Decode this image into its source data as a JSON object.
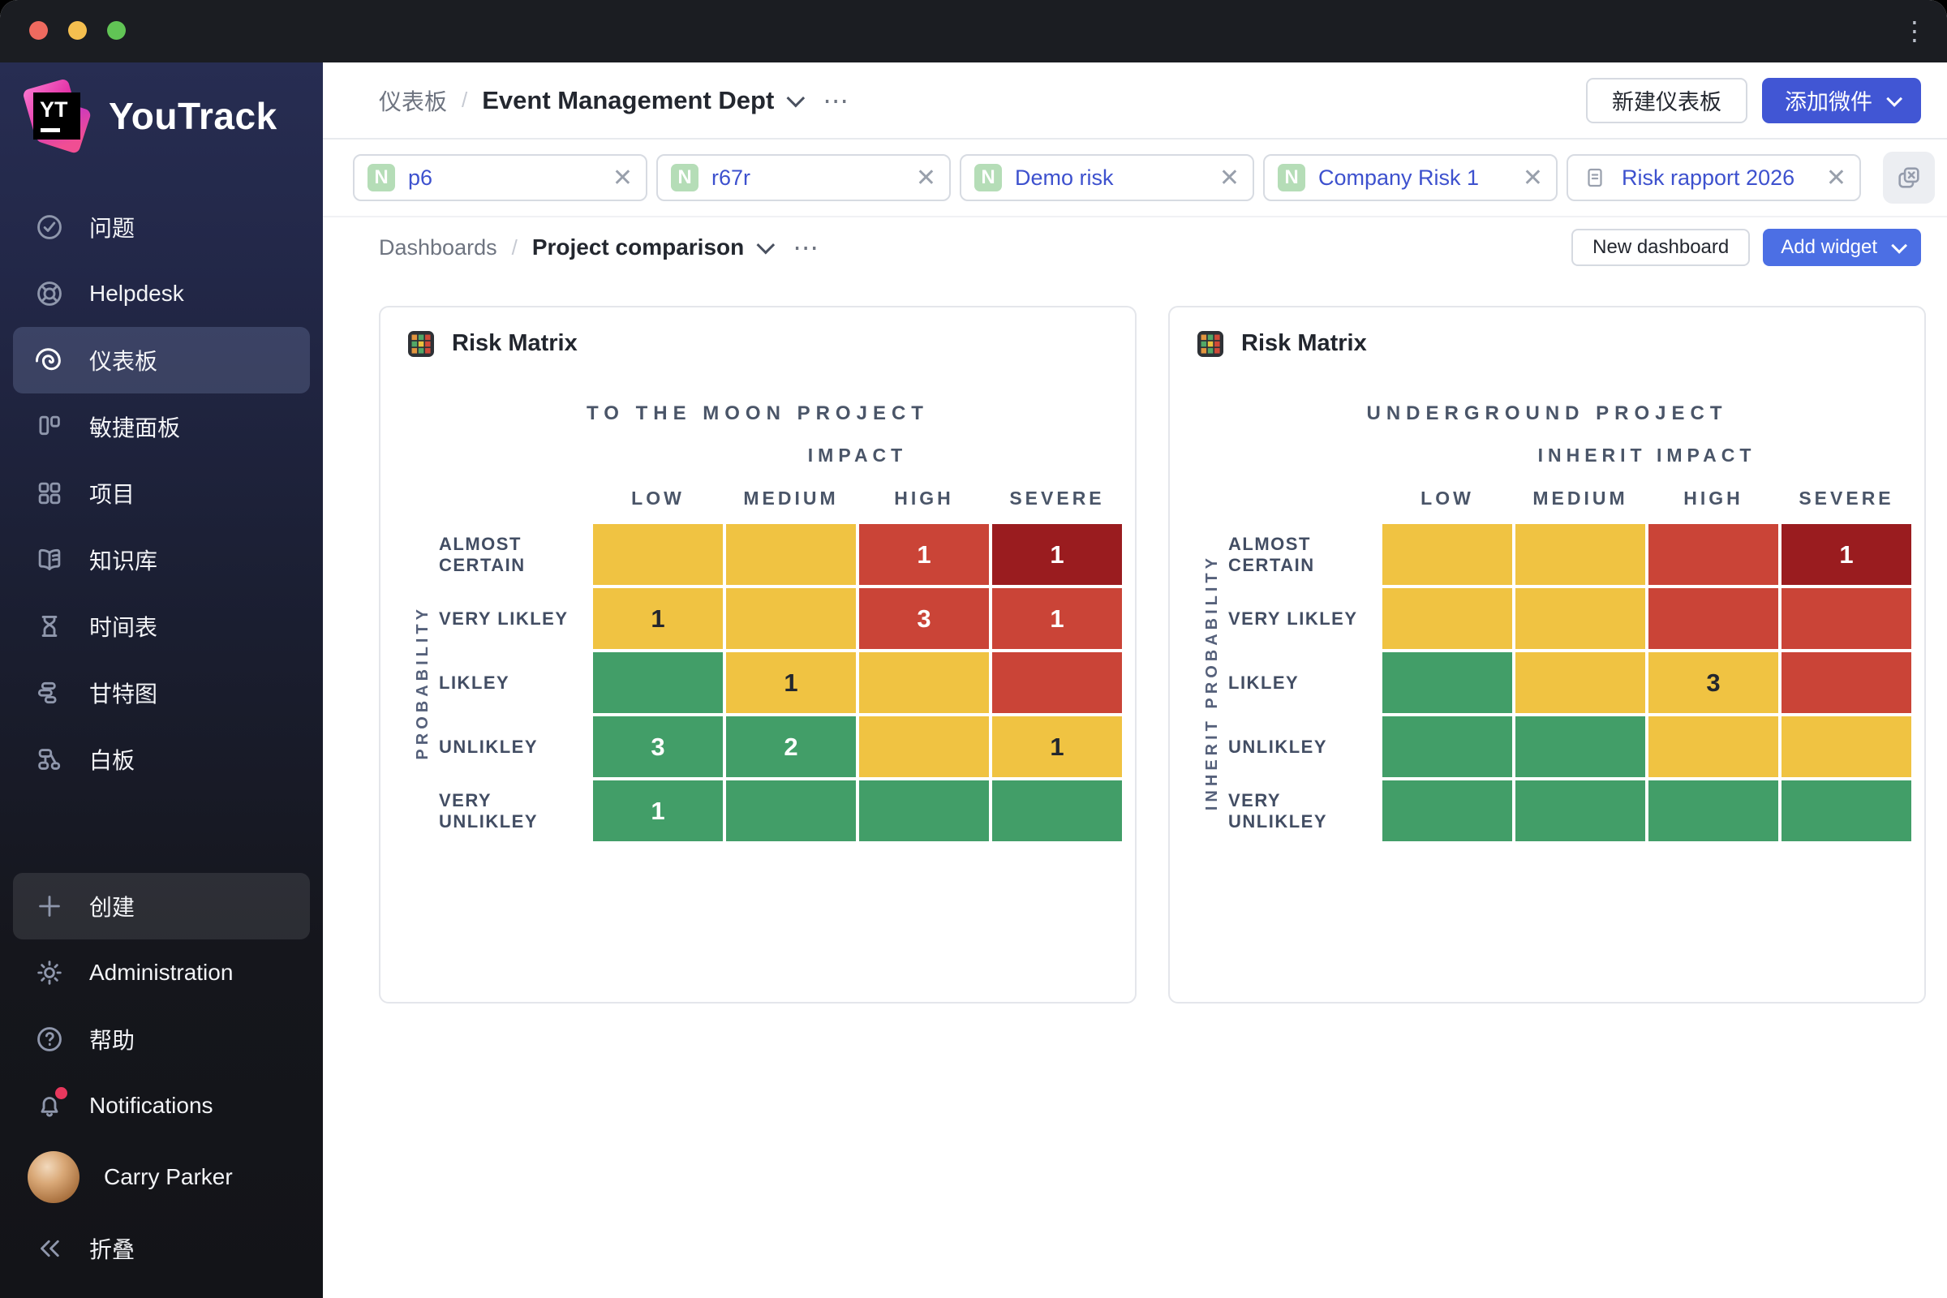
{
  "window": {
    "menu_icon": "⋮"
  },
  "sidebar": {
    "logo": {
      "icon_label": "YT",
      "text": "YouTrack"
    },
    "items": [
      {
        "name": "issues",
        "icon": "check-circle-icon",
        "label": "问题",
        "active": false
      },
      {
        "name": "helpdesk",
        "icon": "helpdesk-icon",
        "label": "Helpdesk",
        "active": false
      },
      {
        "name": "dashboards",
        "icon": "dashboard-icon",
        "label": "仪表板",
        "active": true
      },
      {
        "name": "agile-boards",
        "icon": "agile-board-icon",
        "label": "敏捷面板",
        "active": false
      },
      {
        "name": "projects",
        "icon": "projects-grid-icon",
        "label": "项目",
        "active": false
      },
      {
        "name": "knowledge-base",
        "icon": "knowledge-base-icon",
        "label": "知识库",
        "active": false
      },
      {
        "name": "timesheets",
        "icon": "timesheet-icon",
        "label": "时间表",
        "active": false
      },
      {
        "name": "gantt-charts",
        "icon": "gantt-icon",
        "label": "甘特图",
        "active": false
      },
      {
        "name": "whiteboards",
        "icon": "whiteboard-icon",
        "label": "白板",
        "active": false
      }
    ],
    "footer_items": [
      {
        "name": "create",
        "icon": "plus-icon",
        "label": "创建",
        "active": true,
        "type": "item"
      },
      {
        "name": "administration",
        "icon": "gear-icon",
        "label": "Administration",
        "active": false,
        "type": "item"
      },
      {
        "name": "help",
        "icon": "help-icon",
        "label": "帮助",
        "active": false,
        "type": "item"
      },
      {
        "name": "notifications",
        "icon": "bell-icon",
        "label": "Notifications",
        "active": false,
        "type": "item",
        "badge_dot": true
      },
      {
        "name": "user-profile",
        "icon": "avatar",
        "label": "Carry Parker",
        "active": false,
        "type": "user"
      },
      {
        "name": "collapse",
        "icon": "collapse-icon",
        "label": "折叠",
        "active": false,
        "type": "item"
      }
    ]
  },
  "header": {
    "breadcrumb_root": "仪表板",
    "separator": "/",
    "title": "Event Management Dept",
    "more_icon": "⋯",
    "new_dashboard_label": "新建仪表板",
    "add_widget_label": "添加微件"
  },
  "filter_tabs": [
    {
      "name": "p6",
      "badge": "N",
      "icon": null,
      "label": "p6",
      "close": "✕"
    },
    {
      "name": "r67r",
      "badge": "N",
      "icon": null,
      "label": "r67r",
      "close": "✕"
    },
    {
      "name": "demo-risk",
      "badge": "N",
      "icon": null,
      "label": "Demo risk",
      "close": "✕"
    },
    {
      "name": "company-risk-1",
      "badge": "N",
      "icon": null,
      "label": "Company Risk 1",
      "close": "✕"
    },
    {
      "name": "risk-rapport-2026",
      "badge": null,
      "icon": "document-icon",
      "label": "Risk rapport 2026",
      "close": "✕"
    }
  ],
  "toolbar": {
    "breadcrumb_root": "Dashboards",
    "separator": "/",
    "current": "Project comparison",
    "more_icon": "⋯",
    "new_dashboard_label": "New dashboard",
    "add_widget_label": "Add widget"
  },
  "widgets": [
    {
      "title": "Risk Matrix",
      "subtitle": "TO THE MOON PROJECT",
      "impact_label": "IMPACT",
      "probability_label": "PROBABILITY",
      "columns": [
        "LOW",
        "MEDIUM",
        "HIGH",
        "SEVERE"
      ],
      "rows": [
        {
          "label": "ALMOST CERTAIN",
          "cells": [
            {
              "color": "yellow",
              "value": ""
            },
            {
              "color": "yellow",
              "value": ""
            },
            {
              "color": "red",
              "value": "1"
            },
            {
              "color": "darkred",
              "value": "1"
            }
          ]
        },
        {
          "label": "VERY LIKLEY",
          "cells": [
            {
              "color": "yellow",
              "value": "1"
            },
            {
              "color": "yellow",
              "value": ""
            },
            {
              "color": "red",
              "value": "3"
            },
            {
              "color": "red",
              "value": "1"
            }
          ]
        },
        {
          "label": "LIKLEY",
          "cells": [
            {
              "color": "green",
              "value": ""
            },
            {
              "color": "yellow",
              "value": "1"
            },
            {
              "color": "yellow",
              "value": ""
            },
            {
              "color": "red",
              "value": ""
            }
          ]
        },
        {
          "label": "UNLIKLEY",
          "cells": [
            {
              "color": "green",
              "value": "3"
            },
            {
              "color": "green",
              "value": "2"
            },
            {
              "color": "yellow",
              "value": ""
            },
            {
              "color": "yellow",
              "value": "1"
            }
          ]
        },
        {
          "label": "VERY UNLIKLEY",
          "cells": [
            {
              "color": "green",
              "value": "1"
            },
            {
              "color": "green",
              "value": ""
            },
            {
              "color": "green",
              "value": ""
            },
            {
              "color": "green",
              "value": ""
            }
          ]
        }
      ]
    },
    {
      "title": "Risk Matrix",
      "subtitle": "UNDERGROUND PROJECT",
      "impact_label": "INHERIT IMPACT",
      "probability_label": "INHERIT PROBABILITY",
      "columns": [
        "LOW",
        "MEDIUM",
        "HIGH",
        "SEVERE"
      ],
      "rows": [
        {
          "label": "ALMOST CERTAIN",
          "cells": [
            {
              "color": "yellow",
              "value": ""
            },
            {
              "color": "yellow",
              "value": ""
            },
            {
              "color": "red",
              "value": ""
            },
            {
              "color": "darkred",
              "value": "1"
            }
          ]
        },
        {
          "label": "VERY LIKLEY",
          "cells": [
            {
              "color": "yellow",
              "value": ""
            },
            {
              "color": "yellow",
              "value": ""
            },
            {
              "color": "red",
              "value": ""
            },
            {
              "color": "red",
              "value": ""
            }
          ]
        },
        {
          "label": "LIKLEY",
          "cells": [
            {
              "color": "green",
              "value": ""
            },
            {
              "color": "yellow",
              "value": ""
            },
            {
              "color": "yellow",
              "value": "3"
            },
            {
              "color": "red",
              "value": ""
            }
          ]
        },
        {
          "label": "UNLIKLEY",
          "cells": [
            {
              "color": "green",
              "value": ""
            },
            {
              "color": "green",
              "value": ""
            },
            {
              "color": "yellow",
              "value": ""
            },
            {
              "color": "yellow",
              "value": ""
            }
          ]
        },
        {
          "label": "VERY UNLIKLEY",
          "cells": [
            {
              "color": "green",
              "value": ""
            },
            {
              "color": "green",
              "value": ""
            },
            {
              "color": "green",
              "value": ""
            },
            {
              "color": "green",
              "value": ""
            }
          ]
        }
      ]
    }
  ],
  "colors": {
    "green": "#429E68",
    "yellow": "#F0C342",
    "red": "#CA4437",
    "darkred": "#9A1C1F",
    "accent_blue": "#4156D4",
    "accent_blue_light": "#4C6FE4",
    "badge_green": "#B5DDB7"
  }
}
